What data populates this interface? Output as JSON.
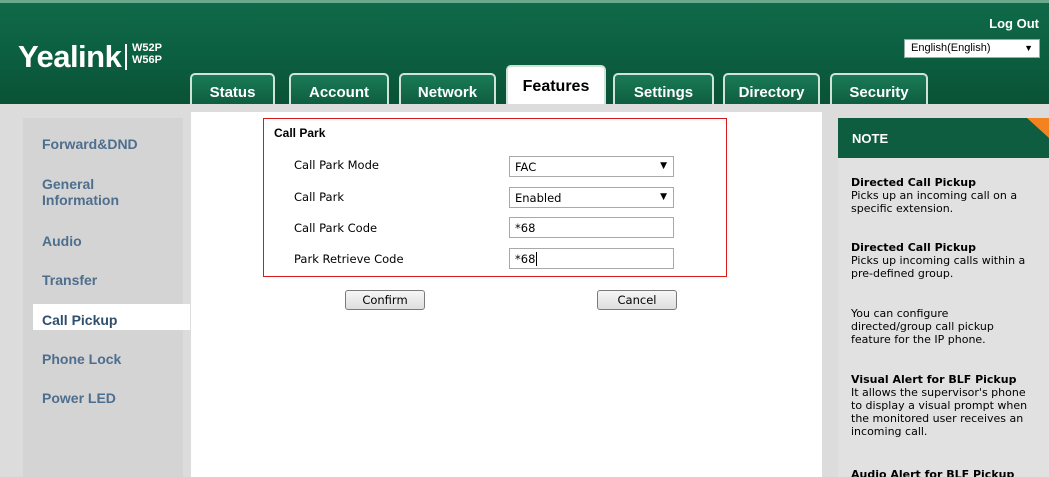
{
  "header": {
    "brand": "Yealink",
    "model_line1": "W52P",
    "model_line2": "W56P",
    "logout": "Log Out",
    "language": "English(English)"
  },
  "tabs": [
    {
      "label": "Status"
    },
    {
      "label": "Account"
    },
    {
      "label": "Network"
    },
    {
      "label": "Features",
      "active": true
    },
    {
      "label": "Settings"
    },
    {
      "label": "Directory"
    },
    {
      "label": "Security"
    }
  ],
  "sidebar": {
    "items": [
      {
        "label": "Forward&DND"
      },
      {
        "label_line1": "General",
        "label_line2": "Information"
      },
      {
        "label": "Audio"
      },
      {
        "label": "Transfer"
      },
      {
        "label": "Call Pickup",
        "active": true
      },
      {
        "label": "Phone Lock"
      },
      {
        "label": "Power LED"
      }
    ]
  },
  "callpark": {
    "title": "Call Park",
    "mode_label": "Call Park Mode",
    "mode_value": "FAC",
    "enable_label": "Call Park",
    "enable_value": "Enabled",
    "code_label": "Call Park Code",
    "code_value": "*68",
    "retrieve_label": "Park Retrieve Code",
    "retrieve_value": "*68"
  },
  "buttons": {
    "confirm": "Confirm",
    "cancel": "Cancel"
  },
  "note": {
    "title": "NOTE",
    "p1_title": "Directed Call Pickup",
    "p1_l1": "Picks up an incoming call on a",
    "p1_l2": "specific extension.",
    "p2_title": "Directed Call Pickup",
    "p2_l1": "Picks up incoming calls within a",
    "p2_l2": "pre-defined group.",
    "p3_l1": "You can configure",
    "p3_l2": "directed/group call pickup",
    "p3_l3": "feature for the IP phone.",
    "p4_title": "Visual Alert for BLF Pickup",
    "p4_l1": "It allows the supervisor's phone",
    "p4_l2": "to display a visual prompt when",
    "p4_l3": "the monitored user receives an",
    "p4_l4": "incoming call.",
    "p5_title": "Audio Alert for BLF Pickup"
  },
  "colors": {
    "header_green": "#0c5e40",
    "nav_text": "#4e6e8e",
    "box_border": "#d7191c",
    "note_corner": "#f58220"
  }
}
